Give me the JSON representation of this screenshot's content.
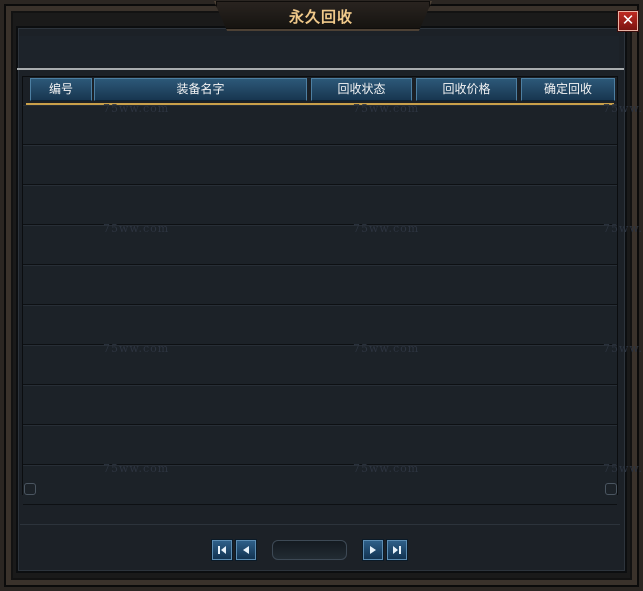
{
  "window": {
    "title": "永久回收",
    "close_glyph": "✕"
  },
  "table": {
    "columns": [
      "编号",
      "装备名字",
      "回收状态",
      "回收价格",
      "确定回收"
    ],
    "rows": [
      {},
      {},
      {},
      {},
      {},
      {},
      {},
      {},
      {},
      {}
    ]
  },
  "watermark": "75ww.com",
  "pager": {
    "first_icon": "first-page-icon",
    "prev_icon": "prev-page-icon",
    "next_icon": "next-page-icon",
    "last_icon": "last-page-icon",
    "page_value": ""
  },
  "colors": {
    "title": "#f0c98a",
    "header": "#2c5878",
    "accent_line": "#c9a04a",
    "close": "#c02a22"
  }
}
